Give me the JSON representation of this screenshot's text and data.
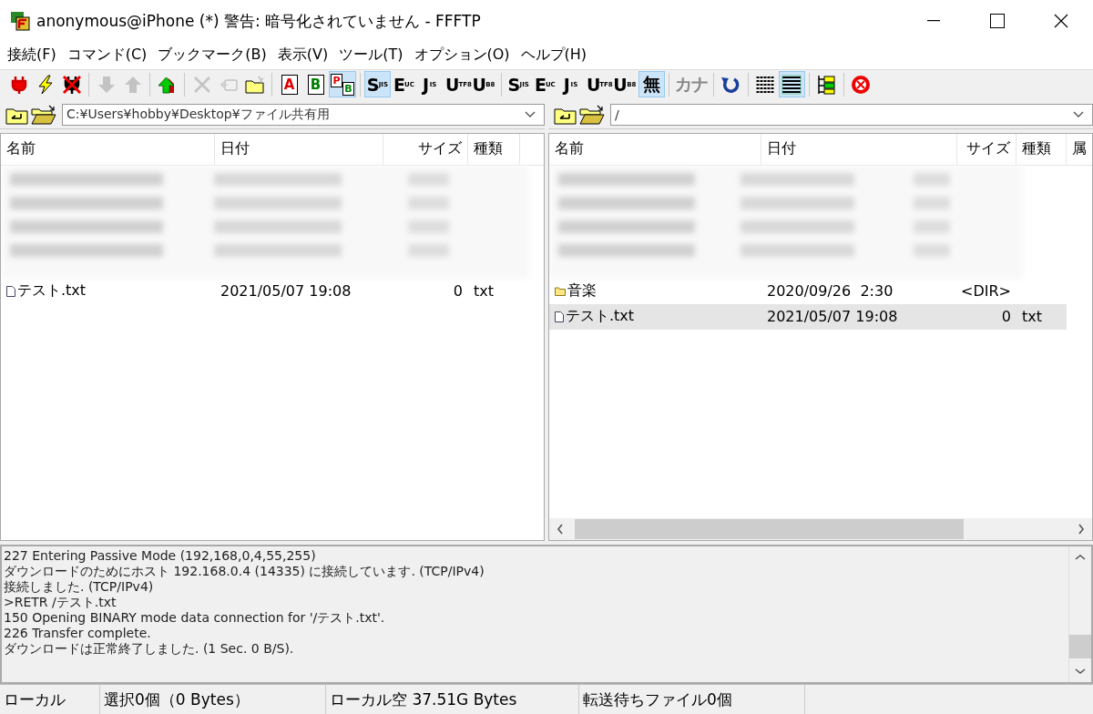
{
  "window": {
    "title": "anonymous@iPhone (*) 警告: 暗号化されていません - FFFTP"
  },
  "menu": [
    "接続(F)",
    "コマンド(C)",
    "ブックマーク(B)",
    "表示(V)",
    "ツール(T)",
    "オプション(O)",
    "ヘルプ(H)"
  ],
  "toolbar": [
    {
      "kind": "plug",
      "selected": false,
      "disabled": false
    },
    {
      "kind": "bolt",
      "selected": false,
      "disabled": false
    },
    {
      "kind": "disconnect",
      "selected": false,
      "disabled": false
    },
    {
      "kind": "separator"
    },
    {
      "kind": "down",
      "selected": false,
      "disabled": true
    },
    {
      "kind": "up",
      "selected": false,
      "disabled": true
    },
    {
      "kind": "separator"
    },
    {
      "kind": "mirror",
      "selected": false,
      "disabled": false
    },
    {
      "kind": "separator"
    },
    {
      "kind": "delete",
      "selected": false,
      "disabled": true
    },
    {
      "kind": "rename",
      "selected": false,
      "disabled": true
    },
    {
      "kind": "newfolder",
      "selected": false,
      "disabled": false
    },
    {
      "kind": "separator"
    },
    {
      "kind": "letter",
      "label": "A",
      "color": "#e00000",
      "selected": false,
      "disabled": false
    },
    {
      "kind": "letter",
      "label": "B",
      "color": "#008000",
      "selected": false,
      "disabled": false
    },
    {
      "kind": "letter",
      "label": "B",
      "sub": "P",
      "color": "#008000",
      "selected": true,
      "disabled": false
    },
    {
      "kind": "separator"
    },
    {
      "kind": "glyph",
      "label": "S",
      "sub": "JIS",
      "selected": true,
      "disabled": false
    },
    {
      "kind": "glyph",
      "label": "E",
      "sub": "UC",
      "selected": false,
      "disabled": false
    },
    {
      "kind": "glyph",
      "label": "J",
      "sub": "IS",
      "selected": false,
      "disabled": false
    },
    {
      "kind": "glyph",
      "label": "U",
      "sub": "TF8",
      "selected": false,
      "disabled": false
    },
    {
      "kind": "glyph",
      "label": "U",
      "sub": "B8",
      "selected": false,
      "disabled": false
    },
    {
      "kind": "separator"
    },
    {
      "kind": "glyph",
      "label": "S",
      "sub": "JIS",
      "selected": false,
      "disabled": false
    },
    {
      "kind": "glyph",
      "label": "E",
      "sub": "UC",
      "selected": false,
      "disabled": false
    },
    {
      "kind": "glyph",
      "label": "J",
      "sub": "IS",
      "selected": false,
      "disabled": false
    },
    {
      "kind": "glyph",
      "label": "U",
      "sub": "TF8",
      "selected": false,
      "disabled": false
    },
    {
      "kind": "glyph",
      "label": "U",
      "sub": "B8",
      "selected": false,
      "disabled": false
    },
    {
      "kind": "glyph",
      "label": "無",
      "selected": true,
      "disabled": false
    },
    {
      "kind": "separator"
    },
    {
      "kind": "glyph",
      "label": "カナ",
      "selected": false,
      "disabled": true
    },
    {
      "kind": "separator"
    },
    {
      "kind": "refresh",
      "selected": false,
      "disabled": false
    },
    {
      "kind": "separator"
    },
    {
      "kind": "list",
      "selected": false,
      "disabled": false
    },
    {
      "kind": "details",
      "selected": true,
      "disabled": false
    },
    {
      "kind": "separator"
    },
    {
      "kind": "tree",
      "selected": false,
      "disabled": false
    },
    {
      "kind": "separator"
    },
    {
      "kind": "stop",
      "selected": false,
      "disabled": false
    }
  ],
  "local": {
    "path": "C:¥Users¥hobby¥Desktop¥ファイル共有用",
    "columns": [
      "名前",
      "日付",
      "サイズ",
      "種類"
    ],
    "rows": [
      {
        "kind": "file",
        "name": "テスト.txt",
        "date": "2021/05/07 19:08",
        "size": "0",
        "type": "txt",
        "selected": false
      }
    ]
  },
  "remote": {
    "path": "/",
    "columns": [
      "名前",
      "日付",
      "サイズ",
      "種類",
      "属"
    ],
    "rows": [
      {
        "kind": "folder",
        "name": "音楽",
        "date": "2020/09/26  2:30",
        "size": "<DIR>",
        "type": "",
        "selected": false
      },
      {
        "kind": "file",
        "name": "テスト.txt",
        "date": "2021/05/07 19:08",
        "size": "0",
        "type": "txt",
        "selected": true
      }
    ]
  },
  "log": [
    "227 Entering Passive Mode (192,168,0,4,55,255)",
    "ダウンロードのためにホスト 192.168.0.4 (14335) に接続しています. (TCP/IPv4)",
    "接続しました. (TCP/IPv4)",
    ">RETR /テスト.txt",
    "150 Opening BINARY mode data connection for '/テスト.txt'.",
    "226 Transfer complete.",
    "ダウンロードは正常終了しました. (1 Sec. 0 B/S)."
  ],
  "status": [
    "ローカル",
    "選択0個（0 Bytes）",
    "ローカル空 37.51G Bytes",
    "転送待ちファイル0個"
  ]
}
